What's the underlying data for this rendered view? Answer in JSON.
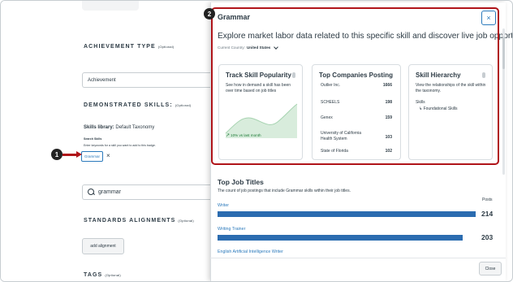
{
  "form": {
    "achievement_type_heading": "ACHIEVEMENT TYPE",
    "achievement_type_optional": "(Optional)",
    "achievement_type_value": "Achievement",
    "demonstrated_skills_heading": "DEMONSTRATED SKILLS:",
    "demonstrated_skills_optional": "(Optional)",
    "skills_library_label": "Skills library:",
    "skills_library_value": "Default Taxonomy",
    "search_skills_label": "Search Skills",
    "search_skills_hint": "Enter keywords for a skill you want to add to this badge.",
    "selected_skill": "Grammar",
    "remove_skill_symbol": "×",
    "search_value": "grammar",
    "standards_heading": "STANDARDS ALIGNMENTS",
    "standards_optional": "(Optional)",
    "add_alignment_label": "add alignment",
    "tags_heading": "TAGS",
    "tags_optional": "(Optional)"
  },
  "callouts": {
    "one": "1",
    "two": "2"
  },
  "panel": {
    "title": "Grammar",
    "close_symbol": "×",
    "subtitle": "Explore market labor data related to this specific skill and discover live job opportunities.",
    "country_label": "Current Country:",
    "country_value": "United States",
    "cards": {
      "popularity": {
        "title": "Track Skill Popularity",
        "description": "See how in demand a skill has been over time based on job titles",
        "trend": "10% vs last month"
      },
      "companies": {
        "title": "Top Companies Posting",
        "rows": [
          {
            "name": "Outlier Inc.",
            "count": "1666"
          },
          {
            "name": "SCHEELS",
            "count": "198"
          },
          {
            "name": "Genex",
            "count": "159"
          },
          {
            "name": "University of California Health System",
            "count": "103"
          },
          {
            "name": "State of Florida",
            "count": "102"
          }
        ]
      },
      "hierarchy": {
        "title": "Skill Hierarchy",
        "description": "View the relationships of the skill within the taxonomy.",
        "level1": "Skills",
        "level2": "Foundational Skills"
      }
    },
    "jobs": {
      "title": "Top Job Titles",
      "description": "The count of job postings that include Grammar skills within their job titles.",
      "posts_header": "Posts",
      "items": [
        {
          "name": "Writer",
          "count": "214",
          "share": 1.0
        },
        {
          "name": "Writing Trainer",
          "count": "203",
          "share": 0.95
        },
        {
          "name": "English Artificial Intelligence Writer",
          "count": "",
          "share": 0
        }
      ]
    },
    "close_button": "Close"
  },
  "colors": {
    "accent": "#2b7abc",
    "bar": "#2b6cb0",
    "highlight": "#b01419",
    "trend": "#1c7a36"
  }
}
